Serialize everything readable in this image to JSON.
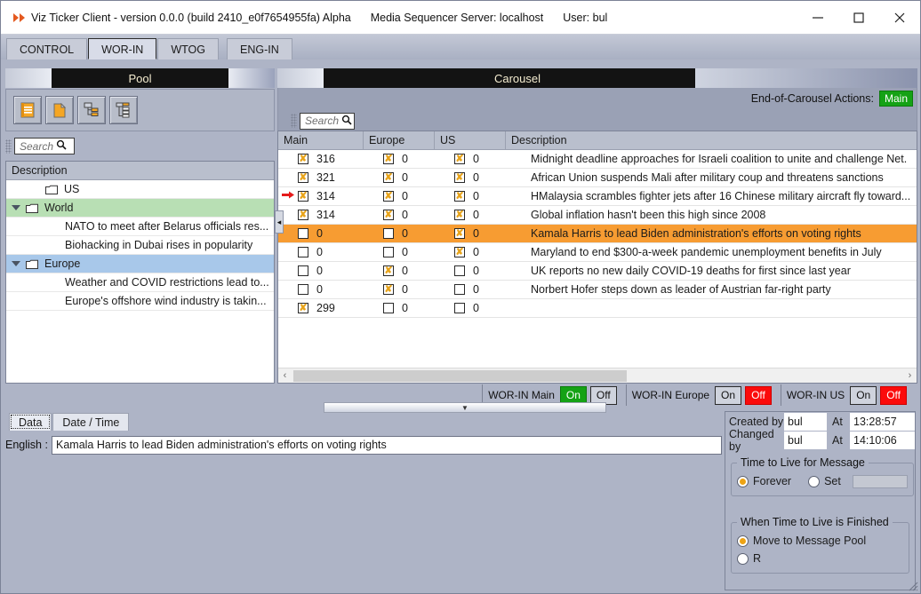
{
  "window": {
    "title": "Viz Ticker Client - version 0.0.0 (build 2410_e0f7654955fa) Alpha",
    "server": "Media Sequencer Server: localhost",
    "user": "User: bul",
    "minimize_label": "minimize-icon",
    "maximize_label": "maximize-icon",
    "close_label": "close-icon"
  },
  "tabs": [
    {
      "label": "CONTROL",
      "selected": false
    },
    {
      "label": "WOR-IN",
      "selected": true
    },
    {
      "label": "WTOG",
      "selected": false
    },
    {
      "label": "ENG-IN",
      "selected": false
    }
  ],
  "pool": {
    "header": "Pool",
    "toolbar": [
      {
        "name": "new-message-icon"
      },
      {
        "name": "new-page-icon"
      },
      {
        "name": "new-group-icon"
      },
      {
        "name": "new-subgroup-icon"
      }
    ],
    "search": {
      "placeholder": "Search"
    },
    "tree_header": "Description",
    "rows": [
      {
        "label": "US",
        "type": "folder",
        "expanded": false,
        "highlight": "none",
        "indent": 1
      },
      {
        "label": "World",
        "type": "folder",
        "expanded": true,
        "highlight": "green",
        "indent": 0
      },
      {
        "label": "NATO to meet after Belarus officials res...",
        "type": "leaf",
        "highlight": "none",
        "indent": 2
      },
      {
        "label": "Biohacking in Dubai rises in popularity",
        "type": "leaf",
        "highlight": "none",
        "indent": 2
      },
      {
        "label": "Europe",
        "type": "folder",
        "expanded": true,
        "highlight": "blue",
        "indent": 0
      },
      {
        "label": "Weather and COVID restrictions lead to...",
        "type": "leaf",
        "highlight": "none",
        "indent": 2
      },
      {
        "label": "Europe's offshore wind industry is takin...",
        "type": "leaf",
        "highlight": "none",
        "indent": 2
      }
    ],
    "collapse_handle": "◂"
  },
  "carousel": {
    "header": "Carousel",
    "end_of_carousel_label": "End-of-Carousel Actions:",
    "end_of_carousel_value": "Main",
    "search": {
      "placeholder": "Search"
    },
    "columns": [
      "Main",
      "Europe",
      "US",
      "Description"
    ],
    "rows": [
      {
        "marker": false,
        "main_checked": true,
        "main_value": "316",
        "europe_checked": true,
        "europe_value": "0",
        "us_checked": true,
        "us_value": "0",
        "description": "Midnight deadline approaches for Israeli coalition to unite and challenge Net.",
        "selected": false
      },
      {
        "marker": false,
        "main_checked": true,
        "main_value": "321",
        "europe_checked": true,
        "europe_value": "0",
        "us_checked": true,
        "us_value": "0",
        "description": "African Union suspends Mali after military coup and threatens sanctions",
        "selected": false
      },
      {
        "marker": true,
        "main_checked": true,
        "main_value": "314",
        "europe_checked": true,
        "europe_value": "0",
        "us_checked": true,
        "us_value": "0",
        "description": "HMalaysia scrambles fighter jets after 16 Chinese military aircraft fly toward...",
        "selected": false
      },
      {
        "marker": false,
        "main_checked": true,
        "main_value": "314",
        "europe_checked": true,
        "europe_value": "0",
        "us_checked": true,
        "us_value": "0",
        "description": "Global inflation hasn't been this high since 2008",
        "selected": false
      },
      {
        "marker": false,
        "main_checked": false,
        "main_value": "0",
        "europe_checked": false,
        "europe_value": "0",
        "us_checked": true,
        "us_value": "0",
        "description": "Kamala Harris to lead Biden administration's efforts on voting rights",
        "selected": true
      },
      {
        "marker": false,
        "main_checked": false,
        "main_value": "0",
        "europe_checked": false,
        "europe_value": "0",
        "us_checked": true,
        "us_value": "0",
        "description": "Maryland to end $300-a-week pandemic unemployment benefits in July",
        "selected": false
      },
      {
        "marker": false,
        "main_checked": false,
        "main_value": "0",
        "europe_checked": true,
        "europe_value": "0",
        "us_checked": false,
        "us_value": "0",
        "description": "UK reports no new daily COVID-19 deaths for first since last year",
        "selected": false
      },
      {
        "marker": false,
        "main_checked": false,
        "main_value": "0",
        "europe_checked": true,
        "europe_value": "0",
        "us_checked": false,
        "us_value": "0",
        "description": "Norbert Hofer steps down as leader of Austrian far-right party",
        "selected": false
      },
      {
        "marker": false,
        "main_checked": true,
        "main_value": "299",
        "europe_checked": false,
        "europe_value": "0",
        "us_checked": false,
        "us_value": "0",
        "description": "",
        "selected": false
      }
    ],
    "scroll_left_icon": "‹",
    "scroll_right_icon": "›"
  },
  "action_bar": [
    {
      "label": "WOR-IN Main",
      "on_label": "On",
      "off_label": "Off",
      "state": "on"
    },
    {
      "label": "WOR-IN Europe",
      "on_label": "On",
      "off_label": "Off",
      "state": "off"
    },
    {
      "label": "WOR-IN US",
      "on_label": "On",
      "off_label": "Off",
      "state": "off"
    }
  ],
  "splitter": {
    "icon": "▼"
  },
  "editor": {
    "tabs": [
      {
        "label": "Data",
        "selected": true
      },
      {
        "label": "Date / Time",
        "selected": false
      }
    ],
    "field_label": "English :",
    "field_value": "Kamala Harris to lead Biden administration's efforts on voting rights"
  },
  "meta": {
    "created_by_label": "Created by",
    "created_by_value": "bul",
    "created_at_label": "At",
    "created_at_value": "13:28:57",
    "changed_by_label": "Changed by",
    "changed_by_value": "bul",
    "changed_at_label": "At",
    "changed_at_value": "14:10:06",
    "ttl": {
      "legend": "Time to Live for Message",
      "forever_label": "Forever",
      "set_label": "Set",
      "selected": "forever",
      "set_value": ""
    },
    "finished": {
      "legend": "When Time to Live is Finished",
      "options": [
        {
          "label": "Move to Message Pool",
          "selected": true
        },
        {
          "label": "R",
          "selected": false
        }
      ]
    }
  },
  "colors": {
    "accent_orange": "#f79c32",
    "on_green": "#15a215",
    "off_red": "#fb0b0b",
    "group_green": "#b8dfb4",
    "group_blue": "#a8c8ea",
    "checkbox_orange": "#e8a41b",
    "marker_red": "#e51b1b",
    "chrome": "#aeb4c6"
  }
}
